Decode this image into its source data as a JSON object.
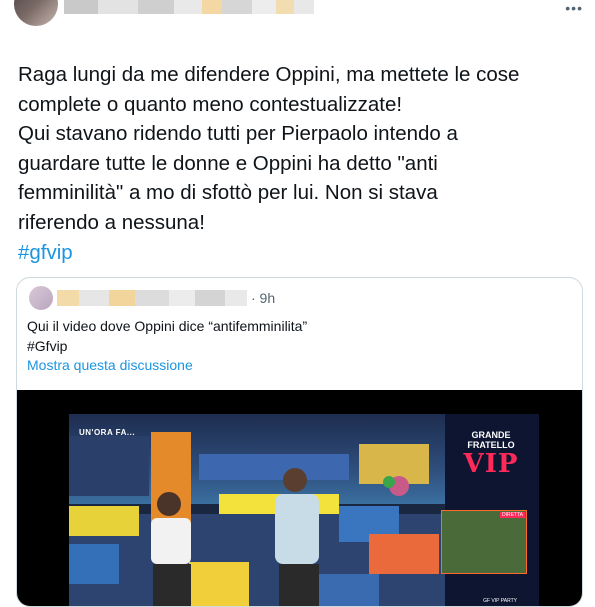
{
  "tweet": {
    "lines": [
      "Raga lungi da me difendere Oppini, ma mettete le cose",
      "complete o quanto meno contestualizzate!",
      "Qui stavano ridendo tutti per Pierpaolo intendo a",
      "guardare tutte le donne e Oppini ha detto \"anti",
      "femminilità\" a mo di sfottò per lui. Non si stava",
      "riferendo a nessuna!"
    ],
    "hashtag": "#gfvip",
    "more_icon": "more-icon"
  },
  "quoted": {
    "time": "· 9h",
    "text_line1": "Qui il video dove Oppini dice “antifemminilita”",
    "text_line2": "#Gfvip",
    "show_thread": "Mostra questa discussione"
  },
  "video": {
    "overlay_text": "UN'ORA FA...",
    "logo_top": "GRANDE",
    "logo_mid": "FRATELLO",
    "logo_vip": "VIP",
    "inset_label": "DIRETTA",
    "party_label": "GF VIP PARTY"
  },
  "colors": {
    "link": "#1b95e0",
    "text": "#0f1419",
    "muted": "#536471",
    "border": "#cfd9de"
  }
}
